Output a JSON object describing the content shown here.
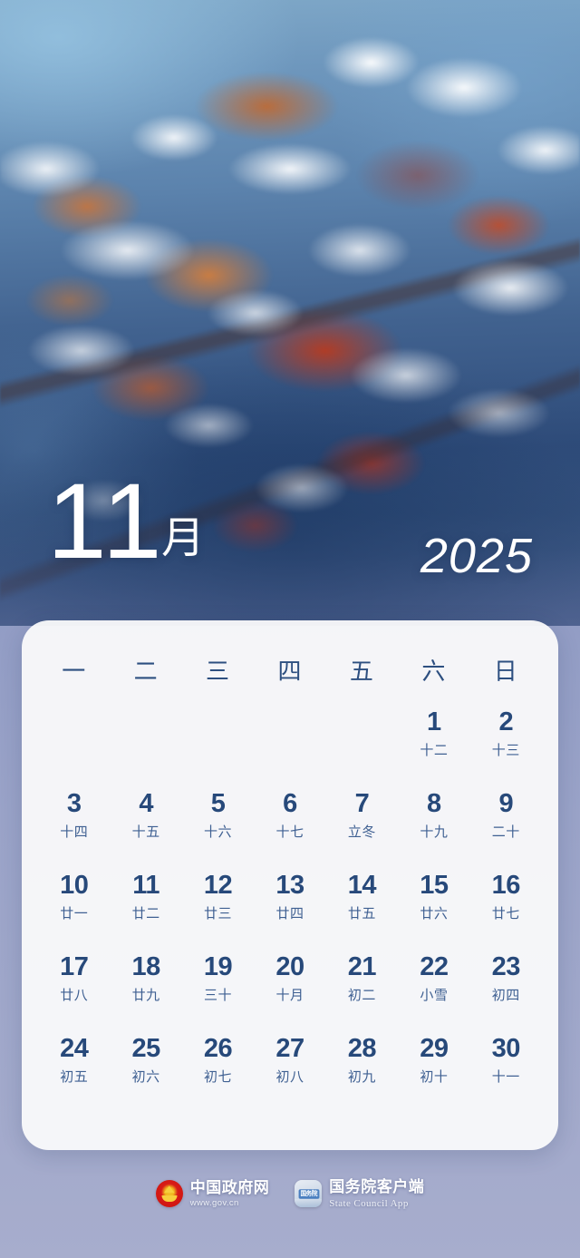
{
  "poster": {
    "background_photo": "frosted-red-leaves-winter-branch",
    "accent_color": "#27497a",
    "card_color": "#fafafb"
  },
  "title": {
    "month_number": "11",
    "month_char": "月",
    "year": "2025"
  },
  "calendar": {
    "weekdays": [
      "一",
      "二",
      "三",
      "四",
      "五",
      "六",
      "日"
    ],
    "weeks": [
      [
        {
          "day": "",
          "lunar": ""
        },
        {
          "day": "",
          "lunar": ""
        },
        {
          "day": "",
          "lunar": ""
        },
        {
          "day": "",
          "lunar": ""
        },
        {
          "day": "",
          "lunar": ""
        },
        {
          "day": "1",
          "lunar": "十二"
        },
        {
          "day": "2",
          "lunar": "十三"
        }
      ],
      [
        {
          "day": "3",
          "lunar": "十四"
        },
        {
          "day": "4",
          "lunar": "十五"
        },
        {
          "day": "5",
          "lunar": "十六"
        },
        {
          "day": "6",
          "lunar": "十七"
        },
        {
          "day": "7",
          "lunar": "立冬"
        },
        {
          "day": "8",
          "lunar": "十九"
        },
        {
          "day": "9",
          "lunar": "二十"
        }
      ],
      [
        {
          "day": "10",
          "lunar": "廿一"
        },
        {
          "day": "11",
          "lunar": "廿二"
        },
        {
          "day": "12",
          "lunar": "廿三"
        },
        {
          "day": "13",
          "lunar": "廿四"
        },
        {
          "day": "14",
          "lunar": "廿五"
        },
        {
          "day": "15",
          "lunar": "廿六"
        },
        {
          "day": "16",
          "lunar": "廿七"
        }
      ],
      [
        {
          "day": "17",
          "lunar": "廿八"
        },
        {
          "day": "18",
          "lunar": "廿九"
        },
        {
          "day": "19",
          "lunar": "三十"
        },
        {
          "day": "20",
          "lunar": "十月"
        },
        {
          "day": "21",
          "lunar": "初二"
        },
        {
          "day": "22",
          "lunar": "小雪"
        },
        {
          "day": "23",
          "lunar": "初四"
        }
      ],
      [
        {
          "day": "24",
          "lunar": "初五"
        },
        {
          "day": "25",
          "lunar": "初六"
        },
        {
          "day": "26",
          "lunar": "初七"
        },
        {
          "day": "27",
          "lunar": "初八"
        },
        {
          "day": "28",
          "lunar": "初九"
        },
        {
          "day": "29",
          "lunar": "初十"
        },
        {
          "day": "30",
          "lunar": "十一"
        }
      ]
    ]
  },
  "footer": {
    "brands": [
      {
        "icon": "national-emblem-icon",
        "name": "中国政府网",
        "sub": "www.gov.cn"
      },
      {
        "icon": "state-council-app-icon",
        "icon_text": "国务院",
        "name": "国务院客户端",
        "sub": "State Council App"
      }
    ]
  }
}
